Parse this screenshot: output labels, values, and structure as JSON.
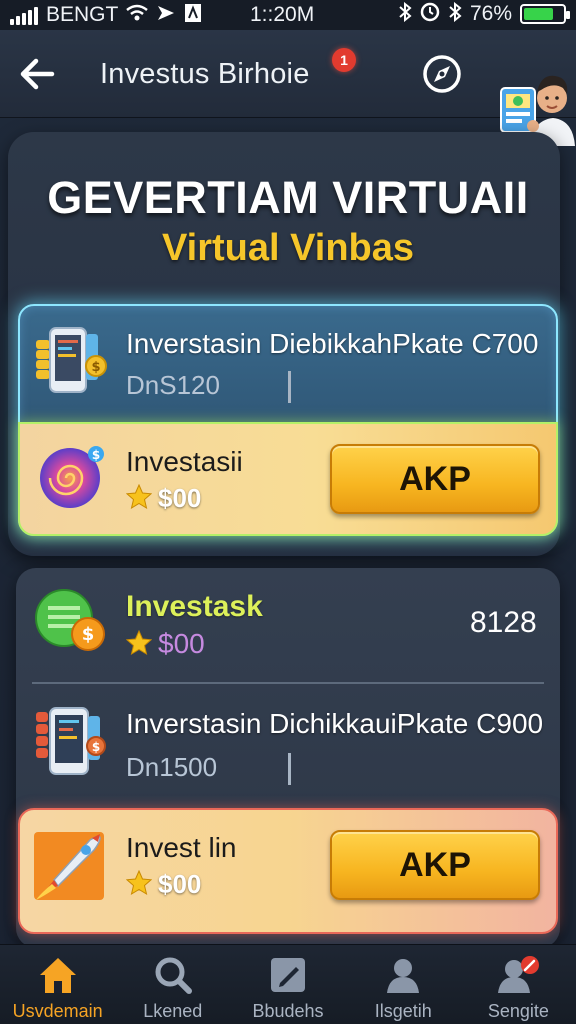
{
  "status_bar": {
    "carrier": "BENGT",
    "time": "1::20M",
    "battery": "76%",
    "battery_level": 0.76
  },
  "header": {
    "title": "Investus Birhoie",
    "notification_count": "1",
    "back_icon": "arrow-left-icon",
    "compass_icon": "compass-icon"
  },
  "hero": {
    "title": "GEVERTIAM VIRTUAII",
    "subtitle": "Virtual Vinbas"
  },
  "card1": {
    "title": "Inverstasin DiebikkahPkate C700",
    "subtitle": "DnS120",
    "offer": {
      "title": "Investasii",
      "price": "$00",
      "button": "AKP"
    }
  },
  "card2": {
    "title": "Investask",
    "price": "$00",
    "count": "8128",
    "item": {
      "title": "Inverstasin DichikkauiPkate C900",
      "subtitle": "Dn1500"
    },
    "offer": {
      "title": "Invest lin",
      "price": "$00",
      "button": "AKP"
    }
  },
  "tabs": [
    {
      "label": "Usvdemain",
      "icon": "home-icon",
      "active": true
    },
    {
      "label": "Lkened",
      "icon": "search-icon",
      "active": false
    },
    {
      "label": "Bbudehs",
      "icon": "edit-icon",
      "active": false
    },
    {
      "label": "Ilsgetih",
      "icon": "user-icon",
      "active": false
    },
    {
      "label": "Sengite",
      "icon": "profile-settings-icon",
      "active": false
    }
  ],
  "colors": {
    "accent_gold": "#f6c62a",
    "active_tab": "#f6a424",
    "button_orange": "#f7b520"
  }
}
